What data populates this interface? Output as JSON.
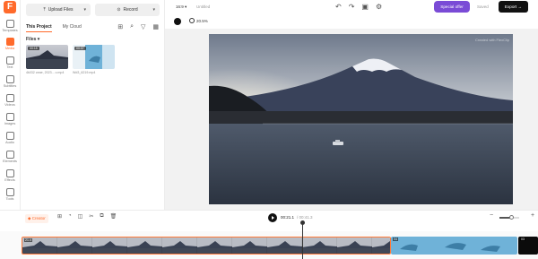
{
  "app": {
    "logo_letter": "F",
    "ratio": "16:9",
    "title": "Untitled"
  },
  "rail": [
    {
      "label": "Templates",
      "icon": "templates-icon"
    },
    {
      "label": "Media",
      "icon": "media-icon",
      "active": true
    },
    {
      "label": "Text",
      "icon": "text-icon"
    },
    {
      "label": "Subtitles",
      "icon": "subtitles-icon"
    },
    {
      "label": "Videos",
      "icon": "videos-icon"
    },
    {
      "label": "Images",
      "icon": "images-icon"
    },
    {
      "label": "Audio",
      "icon": "audio-icon"
    },
    {
      "label": "Elements",
      "icon": "elements-icon"
    },
    {
      "label": "Effects",
      "icon": "effects-icon"
    },
    {
      "label": "Tools",
      "icon": "tools-icon"
    }
  ],
  "panel": {
    "upload_label": "Upload Files",
    "record_label": "Record",
    "tabs": [
      "This Project",
      "My Cloud"
    ],
    "files_label": "Files",
    "files": [
      {
        "name": "4k032 ceae, 2023...",
        "ext": "c.mp4",
        "duration": "00:15"
      },
      {
        "name": "Wd3_6219.mp4",
        "ext": "",
        "duration": "00:07"
      }
    ]
  },
  "topbar": {
    "special_label": "Special offer",
    "save_label": "Saved",
    "export_label": "Export"
  },
  "preview": {
    "speed": "20.5%",
    "watermark": "Created with FlexClip"
  },
  "timeline": {
    "creator_label": "Creator",
    "current_time": "00:21.1",
    "total_time": "/ 00:41.3",
    "zoom_level": 0.6,
    "clip_badges": [
      "21.4",
      "04",
      "03"
    ]
  },
  "colors": {
    "accent": "#ff6a2b",
    "special": "#7a4bd6",
    "export": "#111111"
  }
}
